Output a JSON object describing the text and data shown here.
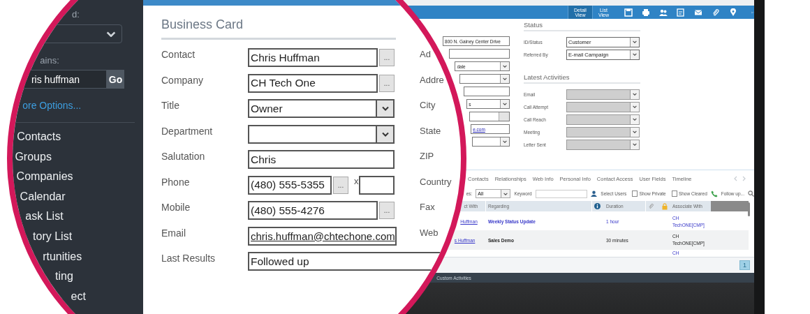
{
  "sidebar": {
    "lookup_label": "d:",
    "contains_label": "ains:",
    "search": {
      "value": "ris huffman"
    },
    "go_button": "Go",
    "more_options_link": "ore Options...",
    "items": [
      {
        "label": "Contacts"
      },
      {
        "label": "Groups"
      },
      {
        "label": "Companies"
      },
      {
        "label": "Calendar"
      },
      {
        "label": "ask List"
      },
      {
        "label": "tory List"
      },
      {
        "label": "rtunities"
      },
      {
        "label": "ting"
      },
      {
        "label": "ect"
      }
    ]
  },
  "business_card": {
    "title": "Business Card",
    "fields": [
      {
        "label": "Contact",
        "kind": "lookup",
        "value": "Chris Huffman",
        "button": "..."
      },
      {
        "label": "Company",
        "kind": "lookup",
        "value": "CH Tech One",
        "button": "..."
      },
      {
        "label": "Title",
        "kind": "select",
        "value": "Owner"
      },
      {
        "label": "Department",
        "kind": "select"
      },
      {
        "label": "Salutation",
        "kind": "text",
        "value": "Chris"
      },
      {
        "label": "Phone",
        "kind": "phone",
        "value": "(480) 555-5355",
        "button": "...",
        "ext_label": "x"
      },
      {
        "label": "Mobile",
        "kind": "lookup",
        "value": "(480) 555-4276",
        "button": "..."
      },
      {
        "label": "Email",
        "kind": "email",
        "value": "chris.huffman@chtechone.com"
      },
      {
        "label": "Last Results",
        "kind": "wide",
        "value": "Followed up"
      }
    ]
  },
  "address_labels": [
    "Ad",
    "Addre",
    "City",
    "State",
    "ZIP",
    "Country",
    "Fax",
    "Web"
  ],
  "toolbar": {
    "views": [
      {
        "label": "Detail View",
        "selected": true
      },
      {
        "label": "List View",
        "selected": false
      }
    ]
  },
  "address_fields": [
    {
      "kind": "text",
      "value": "800 N. Gainey Center Drive"
    },
    {
      "kind": "text"
    },
    {
      "kind": "select",
      "value": "dale"
    },
    {
      "kind": "select"
    },
    {
      "kind": "text"
    },
    {
      "kind": "select",
      "value": "s"
    },
    {
      "kind": "lookup"
    },
    {
      "kind": "link",
      "value": "e.com"
    },
    {
      "kind": "select"
    }
  ],
  "status": {
    "title": "Status",
    "fields": [
      {
        "label": "ID/Status",
        "value": "Customer",
        "disabled": false
      },
      {
        "label": "Referred By",
        "value": "E-mail Campaign",
        "disabled": false
      }
    ]
  },
  "latest_activities": {
    "title": "Latest Activities",
    "fields": [
      {
        "label": "Email",
        "disabled": true
      },
      {
        "label": "Call Attempt",
        "disabled": true
      },
      {
        "label": "Call Reach",
        "disabled": true
      },
      {
        "label": "Meeting",
        "disabled": true
      },
      {
        "label": "Letter Sent",
        "disabled": true
      }
    ]
  },
  "tabs": [
    {
      "label": "Contacts"
    },
    {
      "label": "Relationships"
    },
    {
      "label": "Web Info"
    },
    {
      "label": "Personal Info"
    },
    {
      "label": "Contact Access"
    },
    {
      "label": "User Fields"
    },
    {
      "label": "Timeline"
    }
  ],
  "filter": {
    "type_label": "es:",
    "type_value": "All",
    "keyword_label": "Keyword",
    "select_users": "Select Users",
    "checkboxes": [
      {
        "label": "Show Private",
        "checked": false
      },
      {
        "label": "Show Cleared",
        "checked": false
      }
    ],
    "follow_up": "Follow up..."
  },
  "table": {
    "columns": [
      {
        "kind": "text",
        "label": "ct With"
      },
      {
        "kind": "text",
        "label": "Regarding"
      },
      {
        "kind": "info"
      },
      {
        "kind": "text",
        "label": "Duration"
      },
      {
        "kind": "attach"
      },
      {
        "kind": "lock"
      },
      {
        "kind": "text",
        "label": "Associate With"
      },
      {
        "kind": "blank"
      }
    ],
    "rows": [
      {
        "contact": "Huffman",
        "regarding": "Weekly Status Update",
        "duration": "1 hour",
        "associate": "CH TechONE[CMP]",
        "linked": true
      },
      {
        "contact": "s Huffman",
        "regarding": "Sales Demo",
        "duration": "30 minutes",
        "associate": "CH TechONE[CMP]",
        "linked": false
      },
      {
        "associate": "CH",
        "linked": true
      }
    ]
  },
  "pager": {
    "page": "1"
  },
  "footer": {
    "label": "Custom Activities"
  }
}
